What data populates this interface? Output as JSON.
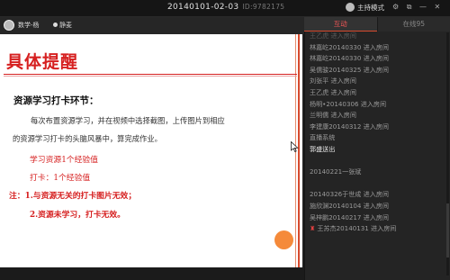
{
  "window": {
    "title": "20140101-02-03",
    "room_id": "ID:9782175"
  },
  "host": {
    "name": "数学-杨",
    "mic_label": "静麦",
    "mode_label": "主持模式"
  },
  "window_icons": "⚙ ⧉ — ✕",
  "slide": {
    "title": "具体提醒",
    "heading": "资源学习打卡环节：",
    "para_line1": "每次布置资源学习，并在视频中选择截图，上传图片到相应",
    "para_line2": "的资源学习打卡的头脑风暴中，算完成作业。",
    "red_line1": "学习资源1个经验值",
    "red_line2": "打卡：1个经验值",
    "red_line3": "注：1.与资源无关的打卡图片无效；",
    "red_line4": "2.资源未学习，打卡无效。"
  },
  "panel": {
    "tabs": [
      {
        "label": "互动",
        "active": true
      },
      {
        "label": "在线95",
        "active": false
      }
    ],
    "items": [
      {
        "text": "王乙虎 进入房间",
        "style": "dim"
      },
      {
        "text": "林嘉屹20140330 进入房间",
        "style": "normal"
      },
      {
        "text": "林嘉屹20140330 进入房间",
        "style": "normal"
      },
      {
        "text": "吴儒骏20140325 进入房间",
        "style": "normal"
      },
      {
        "text": "刘张平 进入房间",
        "style": "normal"
      },
      {
        "text": "王乙虎 进入房间",
        "style": "normal"
      },
      {
        "text": "杨明•20140306 进入房间",
        "style": "normal"
      },
      {
        "text": "兰明儒 进入房间",
        "style": "normal"
      },
      {
        "text": "李建康20140312 进入房间",
        "style": "normal"
      },
      {
        "text": "直播系统",
        "style": "normal"
      },
      {
        "text": "郭盛送出",
        "style": "white"
      },
      {
        "text": "",
        "style": "normal"
      },
      {
        "text": "20140221一张斌",
        "style": "normal"
      },
      {
        "text": "",
        "style": "normal"
      },
      {
        "text": "20140326于世成 进入房间",
        "style": "normal"
      },
      {
        "text": "施欣渊20140104 进入房间",
        "style": "normal"
      },
      {
        "text": "吴梓鹏20140217 进入房间",
        "style": "normal"
      },
      {
        "text": "王苏杰20140131 进入房间",
        "style": "flag"
      }
    ]
  }
}
